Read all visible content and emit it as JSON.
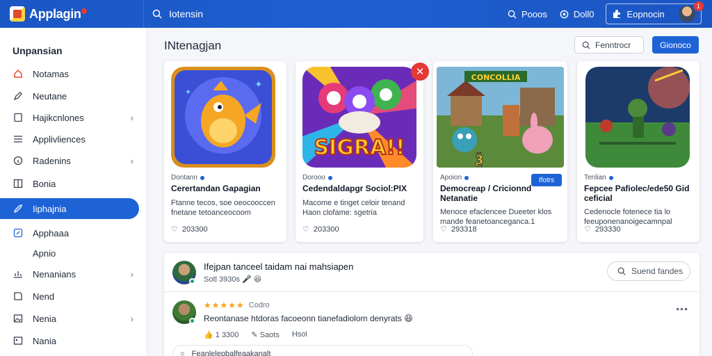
{
  "app": {
    "name": "Applagin",
    "brand_badge": "1"
  },
  "topbar": {
    "search_label": "Iotensin",
    "links": [
      {
        "label": "Pooos",
        "icon": "search-icon"
      },
      {
        "label": "Doll0",
        "icon": "settings-icon"
      }
    ],
    "profile_label": "Eopnocin",
    "profile_badge": "1"
  },
  "sidebar": {
    "title": "Unpansian",
    "items": [
      {
        "label": "Notamas",
        "icon": "home-icon",
        "chevron": false
      },
      {
        "label": "Neutane",
        "icon": "pen-icon",
        "chevron": false
      },
      {
        "label": "Hajikcnlones",
        "icon": "square-icon",
        "chevron": true
      },
      {
        "label": "Applivliences",
        "icon": "list-icon",
        "chevron": false
      },
      {
        "label": "Radenins",
        "icon": "info-icon",
        "chevron": true
      },
      {
        "label": "Bonia",
        "icon": "grid-icon",
        "chevron": false
      },
      {
        "label": "Iiphajnia",
        "icon": "rocket-icon",
        "chevron": false,
        "active": true
      },
      {
        "label": "Apphaaa",
        "icon": "edit-square-icon",
        "chevron": false
      },
      {
        "label": "Apnio",
        "icon": "",
        "chevron": false
      },
      {
        "label": "Nenanians",
        "icon": "chart-icon",
        "chevron": true
      },
      {
        "label": "Nend",
        "icon": "note-icon",
        "chevron": false
      },
      {
        "label": "Nenia",
        "icon": "image-icon",
        "chevron": true
      },
      {
        "label": "Nania",
        "icon": "photo-icon",
        "chevron": false
      }
    ]
  },
  "main": {
    "title": "INtenagjan",
    "filter_button": "Fenntrocr",
    "primary_button": "Gionoco"
  },
  "cards": [
    {
      "meta": "Dontann",
      "name": "Cerertandan Gapagian",
      "desc": "Ftanne tecos, soe oeocooccen fnetane tetoanceocoom",
      "likes": "203300"
    },
    {
      "meta": "Dorooo",
      "name": "Cedendaldapgr Sociol:PIX",
      "desc": "Macome e tinget celoir tenand Haon clofame: sgetria",
      "likes": "203300",
      "close_badge": "✕"
    },
    {
      "meta": "Apoion",
      "name": "Democreap / Cricionnd Netanatie",
      "desc": "Menoce efaclencee Dueeter klos mande feanetoanceganca.1",
      "likes": "293318",
      "install": "Ifotrs"
    },
    {
      "meta": "Tenlian",
      "name": "Fepcee Pafiolec/ede50 Gid ceficial",
      "desc": "Cedenocle fotenece tia lo feeuponenanoigecamnpal",
      "likes": "293330"
    }
  ],
  "card_titles": {
    "card2_art_text": "SIGRA!!",
    "card3_art_text": "CONCOLLIA"
  },
  "reviews": {
    "header_title": "Ifejpan tanceel taidam nai mahsiapen",
    "header_sub": "Sotl 3930s",
    "header_emojis": "🎤 😆",
    "search_label": "Suend fandes",
    "review": {
      "rating_text": "Codro",
      "stars": 5,
      "text": "Reontanase htdoras facoeonn tianefadiolom denyrats",
      "text_emoji": "😆",
      "actions": [
        {
          "icon": "thumb-icon",
          "label": "1 3300"
        },
        {
          "icon": "reply-icon",
          "label": "Saots"
        },
        {
          "icon": "",
          "label": "Hsol"
        }
      ],
      "more": "•••"
    },
    "reply_placeholder": "Feanlelepbalfeaakanalt"
  }
}
